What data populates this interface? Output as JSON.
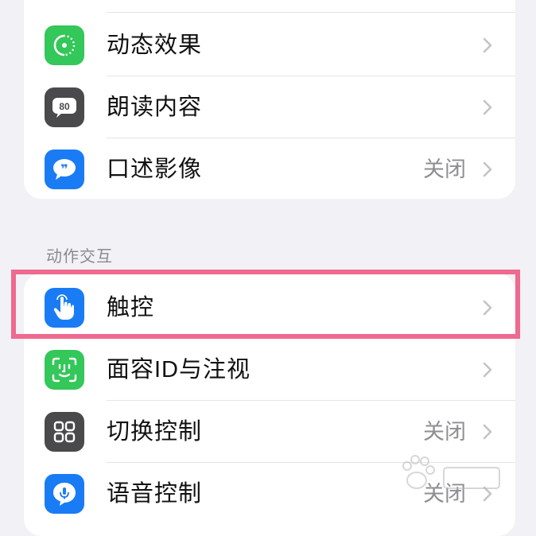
{
  "section_header": "动作交互",
  "colors": {
    "background": "#f1f1f6",
    "card": "#ffffff",
    "highlight": "#f0698f",
    "green": "#34c759",
    "blue": "#1a7cf5",
    "gray": "#4a4a4c"
  },
  "group1": {
    "items": [
      {
        "label": "动态效果",
        "value": "",
        "icon": "motion-icon"
      },
      {
        "label": "朗读内容",
        "value": "",
        "icon": "spoken-content-icon"
      },
      {
        "label": "口述影像",
        "value": "关闭",
        "icon": "audio-description-icon"
      }
    ]
  },
  "group2": {
    "items": [
      {
        "label": "触控",
        "value": "",
        "icon": "touch-hand-icon"
      },
      {
        "label": "面容ID与注视",
        "value": "",
        "icon": "face-id-icon"
      },
      {
        "label": "切换控制",
        "value": "关闭",
        "icon": "switch-control-icon"
      },
      {
        "label": "语音控制",
        "value": "关闭",
        "icon": "voice-control-icon"
      }
    ]
  }
}
